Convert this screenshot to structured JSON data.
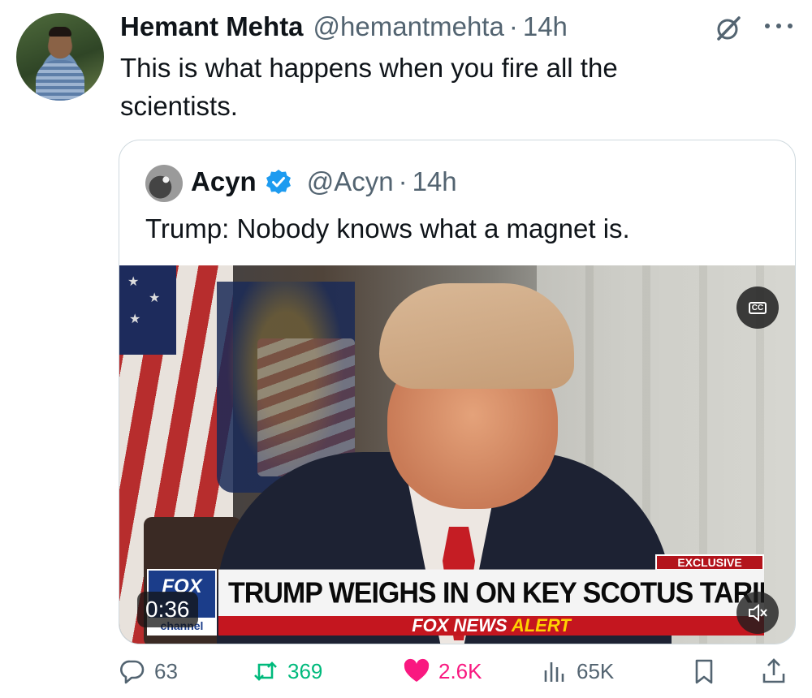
{
  "tweet": {
    "author_name": "Hemant Mehta",
    "author_handle": "@hemantmehta",
    "separator": "·",
    "time": "14h",
    "text": "This is what happens when you fire all the scientists."
  },
  "quote": {
    "author_name": "Acyn",
    "author_handle": "@Acyn",
    "separator": "·",
    "time": "14h",
    "text": "Trump: Nobody knows what a magnet is."
  },
  "video": {
    "cc_label": "CC",
    "exclusive_label": "EXCLUSIVE",
    "headline": "TRUMP WEIGHS IN ON KEY SCOTUS TARIFF CASE",
    "alert_prefix": "FOX NEWS ",
    "alert_word": "ALERT",
    "logo_text": "FOX",
    "logo_sub": "channel",
    "duration": "0:36"
  },
  "actions": {
    "replies": "63",
    "retweets": "369",
    "likes": "2.6K",
    "views": "65K"
  },
  "colors": {
    "retweet": "#00ba7c",
    "like": "#f91880",
    "verified": "#1d9bf0",
    "muted": "#536471"
  }
}
